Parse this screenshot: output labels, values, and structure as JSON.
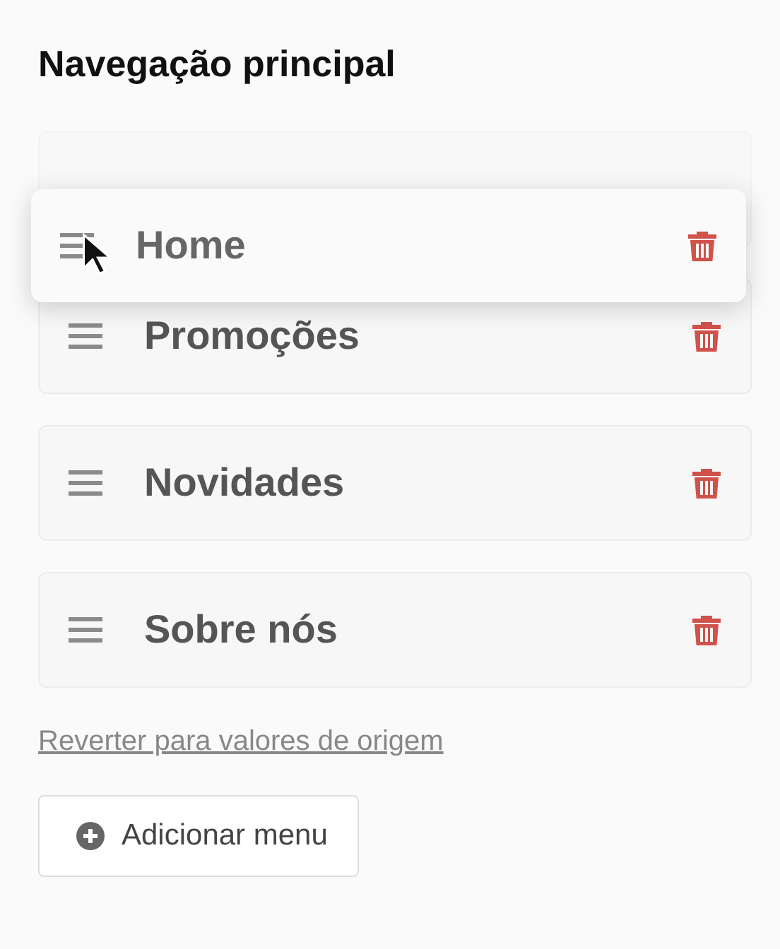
{
  "title": "Navegação principal",
  "items": [
    {
      "label": "Home",
      "dragging": true
    },
    {
      "label": "Promoções",
      "dragging": false
    },
    {
      "label": "Novidades",
      "dragging": false
    },
    {
      "label": "Sobre nós",
      "dragging": false
    }
  ],
  "reset_link": "Reverter para valores de origem",
  "add_button": "Adicionar menu"
}
